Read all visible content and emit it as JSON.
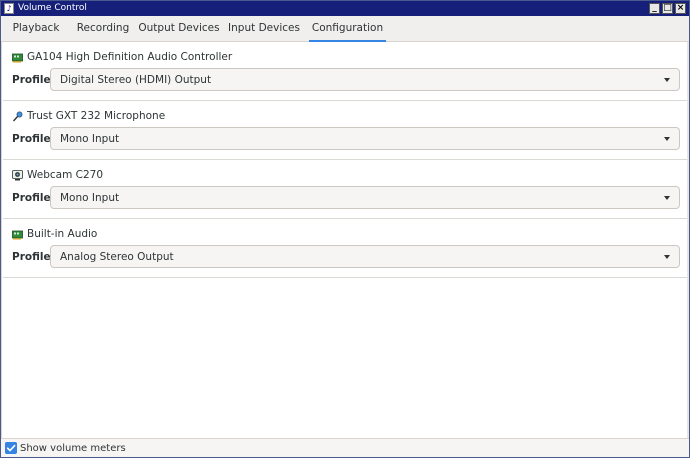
{
  "window": {
    "title": "Volume Control",
    "buttons": [
      "_",
      "□",
      "×"
    ]
  },
  "tabs": [
    {
      "label": "Playback",
      "active": false
    },
    {
      "label": "Recording",
      "active": false
    },
    {
      "label": "Output Devices",
      "active": false
    },
    {
      "label": "Input Devices",
      "active": false
    },
    {
      "label": "Configuration",
      "active": true
    }
  ],
  "cards": [
    {
      "icon": "sound-card-icon",
      "name": "GA104 High Definition Audio Controller",
      "profile_label": "Profile:",
      "profile": "Digital Stereo (HDMI) Output"
    },
    {
      "icon": "microphone-icon",
      "name": "Trust GXT 232 Microphone",
      "profile_label": "Profile:",
      "profile": "Mono Input"
    },
    {
      "icon": "webcam-icon",
      "name": "Webcam C270",
      "profile_label": "Profile:",
      "profile": "Mono Input"
    },
    {
      "icon": "sound-card-icon",
      "name": "Built-in Audio",
      "profile_label": "Profile:",
      "profile": "Analog Stereo Output"
    }
  ],
  "footer": {
    "show_meters_label": "Show volume meters",
    "show_meters_checked": true
  },
  "colors": {
    "titlebar": "#16207a",
    "accent": "#3584e4"
  }
}
